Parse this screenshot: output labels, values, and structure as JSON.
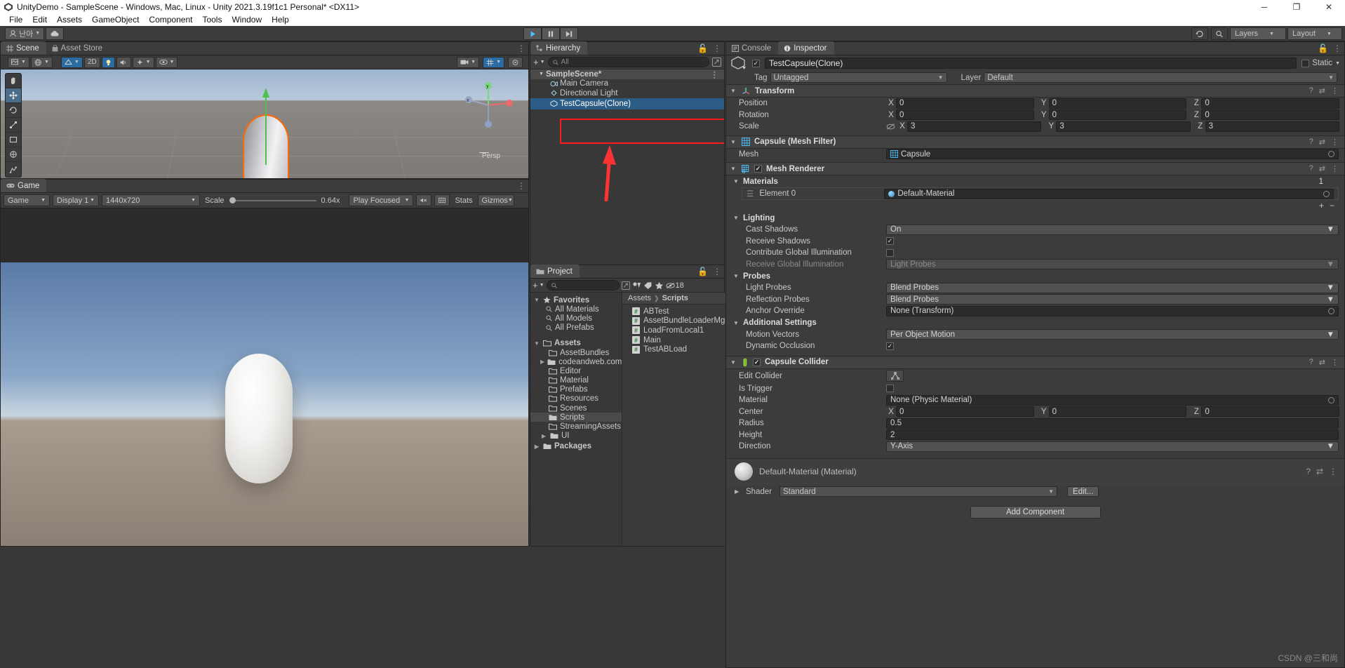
{
  "window": {
    "title": "UnityDemo - SampleScene - Windows, Mac, Linux - Unity 2021.3.19f1c1 Personal* <DX11>",
    "minimize": "─",
    "maximize": "❐",
    "close": "✕"
  },
  "menubar": {
    "items": [
      "File",
      "Edit",
      "Assets",
      "GameObject",
      "Component",
      "Tools",
      "Window",
      "Help"
    ]
  },
  "toolbar": {
    "account_label": "난아",
    "cloud_icon": "cloud-icon",
    "play": "▶",
    "pause": "❘❘",
    "step": "▶❘",
    "history_icon": "undo-history-icon",
    "search_icon": "search-icon",
    "layers": "Layers",
    "layout": "Layout"
  },
  "scene": {
    "tabs": [
      {
        "label": "Scene",
        "icon": "scene-grid-icon",
        "active": true
      },
      {
        "label": "Asset Store",
        "icon": "store-bag-icon",
        "active": false
      }
    ],
    "toolbar": {
      "shading_mode": "shaded-mode-dropdown",
      "twod_label": "2D",
      "light_icon": "lighting-toggle-icon",
      "audio_icon": "audio-toggle-icon",
      "fx_icon": "effects-dropdown-icon",
      "gizmos_icon": "gizmos-dropdown-icon",
      "camera_icon": "scene-camera-icon",
      "grid_icon": "grid-visibility-icon"
    },
    "tools": [
      "hand-tool",
      "move-tool",
      "rotate-tool",
      "scale-tool",
      "rect-tool",
      "transform-tool",
      "custom-tool"
    ],
    "persp_label": "Persp",
    "gizmo": {
      "x": "x",
      "y": "y",
      "z": "z"
    }
  },
  "game": {
    "tabs": [
      {
        "label": "Game",
        "icon": "game-pad-icon",
        "active": true
      }
    ],
    "toolbar": {
      "view_mode": "Game",
      "display": "Display 1",
      "resolution": "1440x720",
      "scale_label": "Scale",
      "scale_value": "0.64x",
      "play_focused": "Play Focused",
      "mute_icon": "mute-audio-icon",
      "stats": "Stats",
      "gizmos": "Gizmos"
    }
  },
  "hierarchy": {
    "tabs": [
      {
        "label": "Hierarchy",
        "icon": "hierarchy-icon",
        "active": true
      }
    ],
    "search_placeholder": "All",
    "add_label": "+",
    "items": [
      {
        "label": "SampleScene*",
        "type": "scene",
        "depth": 0,
        "selected": false
      },
      {
        "label": "Main Camera",
        "type": "gameobject",
        "depth": 1,
        "selected": false
      },
      {
        "label": "Directional Light",
        "type": "gameobject",
        "depth": 1,
        "selected": false
      },
      {
        "label": "TestCapsule(Clone)",
        "type": "gameobject",
        "depth": 1,
        "selected": true
      }
    ]
  },
  "project": {
    "tabs": [
      {
        "label": "Project",
        "icon": "folder-icon",
        "active": true
      }
    ],
    "search_placeholder": "",
    "hidden_count": "18",
    "breadcrumb": [
      "Assets",
      "Scripts"
    ],
    "favorites_label": "Favorites",
    "favorites": [
      "All Materials",
      "All Models",
      "All Prefabs"
    ],
    "assets_label": "Assets",
    "folders": [
      {
        "label": "AssetBundles",
        "expandable": false,
        "selected": false
      },
      {
        "label": "codeandweb.com",
        "expandable": true,
        "selected": false
      },
      {
        "label": "Editor",
        "expandable": false,
        "selected": false
      },
      {
        "label": "Material",
        "expandable": false,
        "selected": false
      },
      {
        "label": "Prefabs",
        "expandable": false,
        "selected": false
      },
      {
        "label": "Resources",
        "expandable": false,
        "selected": false
      },
      {
        "label": "Scenes",
        "expandable": false,
        "selected": false
      },
      {
        "label": "Scripts",
        "expandable": false,
        "selected": true
      },
      {
        "label": "StreamingAssets",
        "expandable": false,
        "selected": false
      },
      {
        "label": "UI",
        "expandable": true,
        "selected": false
      }
    ],
    "packages_label": "Packages",
    "files": [
      "ABTest",
      "AssetBundleLoaderMgr",
      "LoadFromLocal1",
      "Main",
      "TestABLoad"
    ]
  },
  "inspector": {
    "tabs": [
      {
        "label": "Console",
        "icon": "console-icon",
        "active": false
      },
      {
        "label": "Inspector",
        "icon": "info-icon",
        "active": true
      }
    ],
    "object_name": "TestCapsule(Clone)",
    "enabled": true,
    "static_label": "Static",
    "tag_label": "Tag",
    "tag_value": "Untagged",
    "layer_label": "Layer",
    "layer_value": "Default",
    "components": {
      "transform": {
        "title": "Transform",
        "position": {
          "label": "Position",
          "x": "0",
          "y": "0",
          "z": "0"
        },
        "rotation": {
          "label": "Rotation",
          "x": "0",
          "y": "0",
          "z": "0"
        },
        "scale": {
          "label": "Scale",
          "x": "3",
          "y": "3",
          "z": "3"
        }
      },
      "mesh_filter": {
        "title": "Capsule (Mesh Filter)",
        "mesh_label": "Mesh",
        "mesh_value": "Capsule"
      },
      "mesh_renderer": {
        "title": "Mesh Renderer",
        "enabled": true,
        "materials_label": "Materials",
        "materials_count": "1",
        "element_label": "Element 0",
        "element_value": "Default-Material",
        "add_btn": "+",
        "remove_btn": "−",
        "lighting_label": "Lighting",
        "cast_shadows": {
          "label": "Cast Shadows",
          "value": "On"
        },
        "receive_shadows": {
          "label": "Receive Shadows",
          "value": true
        },
        "contribute_gi": {
          "label": "Contribute Global Illumination",
          "value": false
        },
        "receive_gi": {
          "label": "Receive Global Illumination",
          "value": "Light Probes"
        },
        "probes_label": "Probes",
        "light_probes": {
          "label": "Light Probes",
          "value": "Blend Probes"
        },
        "reflection_probes": {
          "label": "Reflection Probes",
          "value": "Blend Probes"
        },
        "anchor_override": {
          "label": "Anchor Override",
          "value": "None (Transform)"
        },
        "additional_label": "Additional Settings",
        "motion_vectors": {
          "label": "Motion Vectors",
          "value": "Per Object Motion"
        },
        "dynamic_occlusion": {
          "label": "Dynamic Occlusion",
          "value": true
        }
      },
      "capsule_collider": {
        "title": "Capsule Collider",
        "enabled": true,
        "edit_collider": {
          "label": "Edit Collider"
        },
        "is_trigger": {
          "label": "Is Trigger",
          "value": false
        },
        "material": {
          "label": "Material",
          "value": "None (Physic Material)"
        },
        "center": {
          "label": "Center",
          "x": "0",
          "y": "0",
          "z": "0"
        },
        "radius": {
          "label": "Radius",
          "value": "0.5"
        },
        "height": {
          "label": "Height",
          "value": "2"
        },
        "direction": {
          "label": "Direction",
          "value": "Y-Axis"
        }
      },
      "material_asset": {
        "title": "Default-Material (Material)",
        "shader_label": "Shader",
        "shader_value": "Standard",
        "edit_label": "Edit..."
      }
    },
    "add_component": "Add Component"
  },
  "watermark": "CSDN @三和尚",
  "colors": {
    "selection_blue": "#2c5d87",
    "annotation_red": "#ff1a1a",
    "outline_orange": "#ff6a00",
    "panel_bg": "#383838",
    "header_bg": "#3c3c3c"
  }
}
